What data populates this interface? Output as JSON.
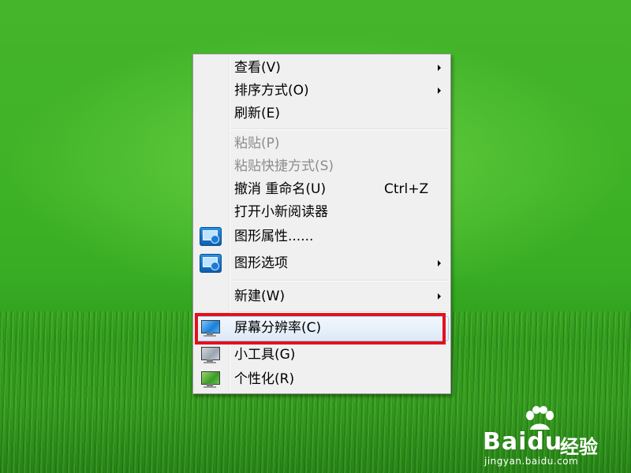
{
  "menu": {
    "items": [
      {
        "label": "查看(V)"
      },
      {
        "label": "排序方式(O)"
      },
      {
        "label": "刷新(E)"
      },
      {
        "label": "粘贴(P)"
      },
      {
        "label": "粘贴快捷方式(S)"
      },
      {
        "label": "撤消 重命名(U)",
        "shortcut": "Ctrl+Z"
      },
      {
        "label": "打开小新阅读器"
      },
      {
        "label": "图形属性......",
        "icon": "intel-graphics-icon"
      },
      {
        "label": "图形选项",
        "icon": "intel-graphics-icon"
      },
      {
        "label": "新建(W)"
      },
      {
        "label": "屏幕分辨率(C)",
        "icon": "monitor-icon"
      },
      {
        "label": "小工具(G)",
        "icon": "gadgets-icon"
      },
      {
        "label": "个性化(R)",
        "icon": "personalize-icon"
      }
    ]
  },
  "watermark": {
    "brand_latin": "Bai",
    "brand_du": "du",
    "brand_cn": "经验",
    "url": "jingyan.baidu.com"
  },
  "colors": {
    "desktop_green": "#3eb226",
    "menu_bg": "#f0f0f0",
    "highlight_box": "#e3111b"
  }
}
